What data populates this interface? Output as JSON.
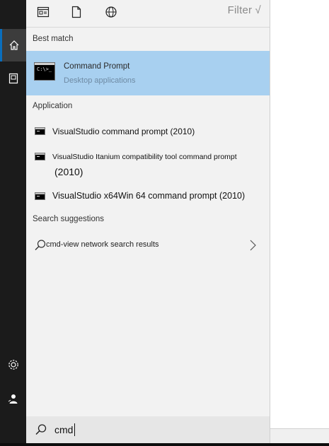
{
  "toolbar": {
    "filter_label": "Filter √",
    "icons": [
      "apps-icon",
      "document-icon",
      "web-icon"
    ]
  },
  "sections": {
    "best_match": "Best match",
    "application": "Application",
    "search_suggestions": "Search suggestions"
  },
  "best_match": {
    "title": "Command Prompt",
    "subtitle": "Desktop applications"
  },
  "applications": [
    {
      "label": "VisualStudio command prompt (2010)"
    },
    {
      "label": "VisualStudio Itanium compatibility tool command prompt",
      "label_line2": "(2010)"
    },
    {
      "label": "VisualStudio x64Win 64 command prompt (2010)"
    }
  ],
  "suggestion": {
    "label": "cmd-view network search results"
  },
  "search": {
    "value": "cmd"
  },
  "rail": {
    "icons": [
      "home-icon",
      "device-icon",
      "settings-icon",
      "user-icon"
    ]
  },
  "colors": {
    "accent": "#0a6ebd",
    "selection": "#a8d0f0",
    "rail": "#1b1b1b",
    "panel": "#f2f2f2"
  }
}
